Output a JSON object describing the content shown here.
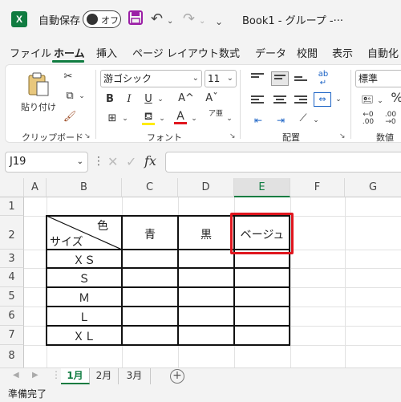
{
  "titlebar": {
    "autosave_label": "自動保存",
    "autosave_state": "オフ",
    "doc_title": "Book1 - グループ -···"
  },
  "ribbon_tabs": [
    "ファイル",
    "ホーム",
    "挿入",
    "ページ レイアウト",
    "数式",
    "データ",
    "校閲",
    "表示",
    "自動化"
  ],
  "active_tab": "ホーム",
  "ribbon": {
    "paste_label": "貼り付け",
    "clipboard_group": "クリップボード",
    "font_name": "游ゴシック",
    "font_size": "11",
    "bold": "B",
    "italic": "I",
    "underline": "U",
    "grow_font": "A^",
    "shrink_font": "Aˇ",
    "font_color_glyph": "A",
    "phonetic_glyph": "ア亜",
    "font_group": "フォント",
    "alignment_group": "配置",
    "number_format": "標準",
    "percent_glyph": "%",
    "number_group": "数値",
    "wrap_glyph": "ab"
  },
  "formula_bar": {
    "name_box": "J19",
    "fx": "fx",
    "formula": ""
  },
  "grid": {
    "columns": [
      "A",
      "B",
      "C",
      "D",
      "E",
      "F",
      "G"
    ],
    "selected_column": "E",
    "rows": [
      "1",
      "2",
      "3",
      "4",
      "5",
      "6",
      "7",
      "8"
    ],
    "table": {
      "corner_top": "色",
      "corner_bottom": "サイズ",
      "headers": [
        "青",
        "黒",
        "ベージュ"
      ],
      "sizes": [
        "ＸＳ",
        "Ｓ",
        "Ｍ",
        "Ｌ",
        "ＸＬ"
      ]
    }
  },
  "sheets": [
    "1月",
    "2月",
    "3月"
  ],
  "active_sheet": "1月",
  "status": "準備完了",
  "colors": {
    "accent": "#107c41",
    "highlight": "#e0161e",
    "ribbon_bg": "#f3f3f3",
    "save_icon": "#9b1fa6"
  }
}
